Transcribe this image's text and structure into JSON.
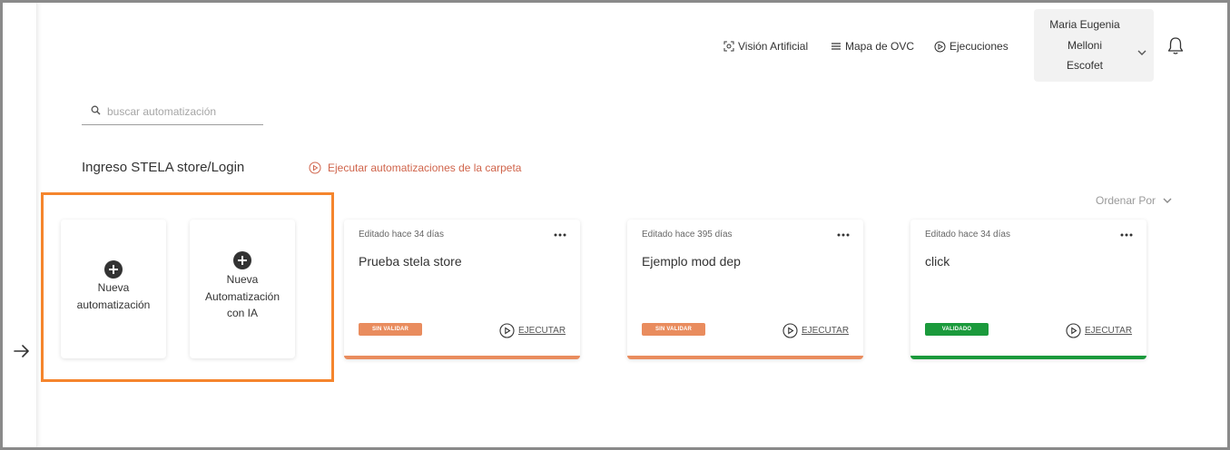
{
  "header": {
    "nav": [
      {
        "label": "Visión Artificial",
        "icon": "vision-icon"
      },
      {
        "label": "Mapa de OVC",
        "icon": "menu-lines-icon"
      },
      {
        "label": "Ejecuciones",
        "icon": "play-circle-icon"
      }
    ],
    "user": {
      "line1": "Maria Eugenia",
      "line2": "Melloni",
      "line3": "Escofet"
    },
    "bell_icon": "bell-icon"
  },
  "search": {
    "placeholder": "buscar automatización",
    "value": ""
  },
  "folder": {
    "title": "Ingreso STELA store/Login",
    "run_all_label": "Ejecutar automatizaciones de la carpeta"
  },
  "sort": {
    "label": "Ordenar Por"
  },
  "new_cards": {
    "manual": {
      "line1": "Nueva",
      "line2": "automatización"
    },
    "ai": {
      "line1": "Nueva",
      "line2": "Automatización",
      "line3": "con IA"
    }
  },
  "automations": [
    {
      "edited": "Editado hace 34 días",
      "name": "Prueba stela store",
      "status": "SIN VALIDAR",
      "status_color": "#e98c5e",
      "bar_color": "#e98c5e",
      "run_label": "EJECUTAR"
    },
    {
      "edited": "Editado hace 395 días",
      "name": "Ejemplo mod dep",
      "status": "SIN VALIDAR",
      "status_color": "#e98c5e",
      "bar_color": "#e98c5e",
      "run_label": "EJECUTAR"
    },
    {
      "edited": "Editado hace 34 días",
      "name": "click",
      "status": "VALIDADO",
      "status_color": "#1b9a3c",
      "bar_color": "#1b9a3c",
      "run_label": "EJECUTAR"
    }
  ],
  "colors": {
    "accent": "#f5852d",
    "link": "#d0654c"
  }
}
